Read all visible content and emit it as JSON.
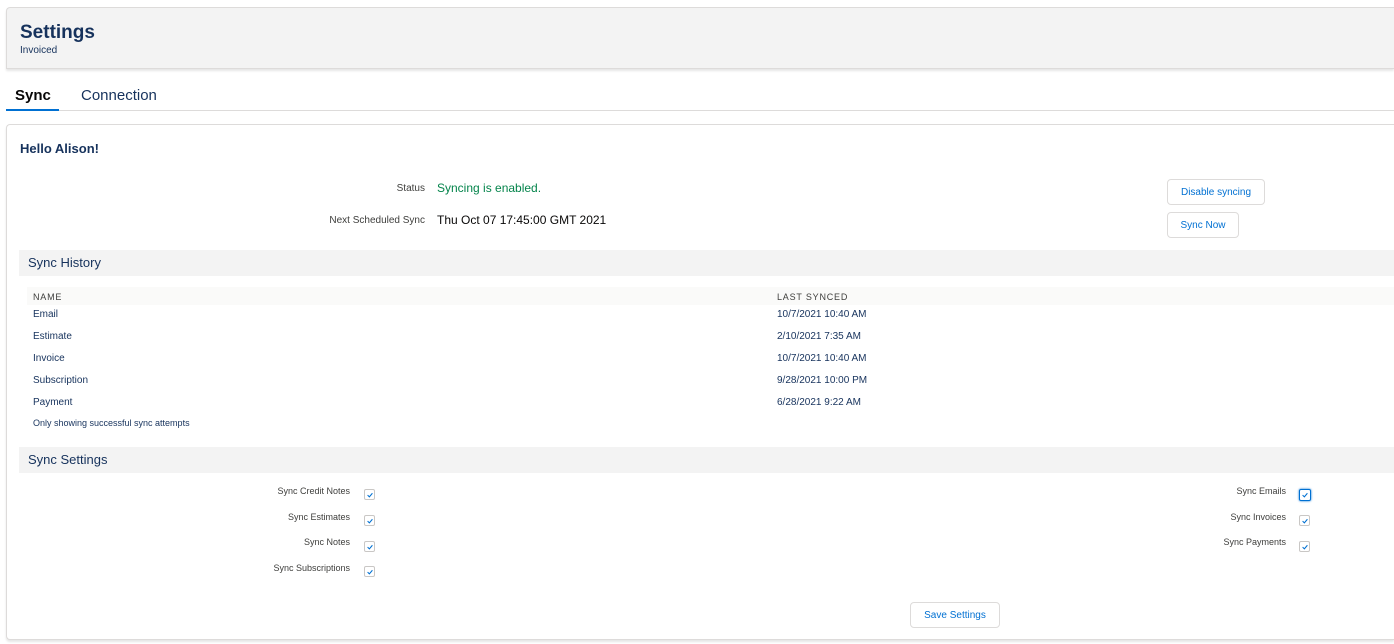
{
  "header": {
    "title": "Settings",
    "subtitle": "Invoiced"
  },
  "tabs": [
    {
      "label": "Sync"
    },
    {
      "label": "Connection"
    }
  ],
  "card": {
    "greeting": "Hello Alison!",
    "status_label": "Status",
    "status_value": "Syncing is enabled.",
    "next_sync_label": "Next Scheduled Sync",
    "next_sync_value": "Thu Oct 07 17:45:00 GMT 2021",
    "disable_button": "Disable syncing",
    "sync_now_button": "Sync Now"
  },
  "history": {
    "title": "Sync History",
    "columns": [
      "NAME",
      "LAST SYNCED"
    ],
    "rows": [
      {
        "name": "Email",
        "last": "10/7/2021 10:40 AM"
      },
      {
        "name": "Estimate",
        "last": "2/10/2021 7:35 AM"
      },
      {
        "name": "Invoice",
        "last": "10/7/2021 10:40 AM"
      },
      {
        "name": "Subscription",
        "last": "9/28/2021 10:00 PM"
      },
      {
        "name": "Payment",
        "last": "6/28/2021 9:22 AM"
      }
    ],
    "note": "Only showing successful sync attempts"
  },
  "settings": {
    "title": "Sync Settings",
    "left": [
      {
        "label": "Sync Credit Notes",
        "checked": true
      },
      {
        "label": "Sync Estimates",
        "checked": true
      },
      {
        "label": "Sync Notes",
        "checked": true
      },
      {
        "label": "Sync Subscriptions",
        "checked": true
      }
    ],
    "right": [
      {
        "label": "Sync Emails",
        "checked": true
      },
      {
        "label": "Sync Invoices",
        "checked": true
      },
      {
        "label": "Sync Payments",
        "checked": true
      }
    ],
    "save_button": "Save Settings"
  },
  "colors": {
    "accent": "#0070d2",
    "success": "#04844b",
    "text": "#16325c"
  }
}
